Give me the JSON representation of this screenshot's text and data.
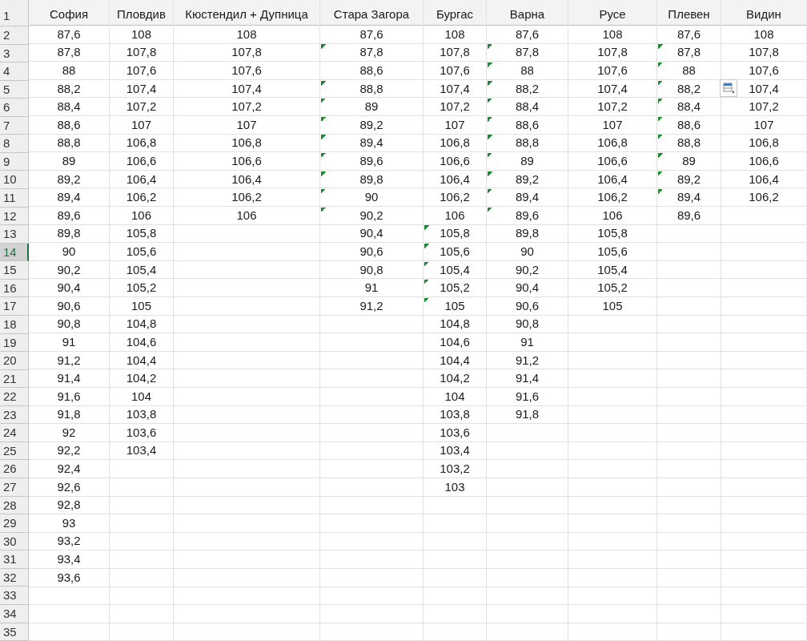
{
  "row_headers": [
    {
      "label": "1",
      "selected": false
    },
    {
      "label": "2",
      "selected": false
    },
    {
      "label": "3",
      "selected": false
    },
    {
      "label": "4",
      "selected": false
    },
    {
      "label": "5",
      "selected": false
    },
    {
      "label": "6",
      "selected": false
    },
    {
      "label": "7",
      "selected": false
    },
    {
      "label": "8",
      "selected": false
    },
    {
      "label": "9",
      "selected": false
    },
    {
      "label": "10",
      "selected": false
    },
    {
      "label": "11",
      "selected": false
    },
    {
      "label": "12",
      "selected": false
    },
    {
      "label": "13",
      "selected": false
    },
    {
      "label": "14",
      "selected": true
    },
    {
      "label": "15",
      "selected": false
    },
    {
      "label": "16",
      "selected": false
    },
    {
      "label": "17",
      "selected": false
    },
    {
      "label": "18",
      "selected": false
    },
    {
      "label": "19",
      "selected": false
    },
    {
      "label": "20",
      "selected": false
    },
    {
      "label": "21",
      "selected": false
    },
    {
      "label": "22",
      "selected": false
    },
    {
      "label": "23",
      "selected": false
    },
    {
      "label": "24",
      "selected": false
    },
    {
      "label": "25",
      "selected": false
    },
    {
      "label": "26",
      "selected": false
    },
    {
      "label": "27",
      "selected": false
    },
    {
      "label": "28",
      "selected": false
    },
    {
      "label": "29",
      "selected": false
    },
    {
      "label": "30",
      "selected": false
    },
    {
      "label": "31",
      "selected": false
    },
    {
      "label": "32",
      "selected": false
    },
    {
      "label": "33",
      "selected": false
    },
    {
      "label": "34",
      "selected": false
    },
    {
      "label": "35",
      "selected": false
    }
  ],
  "columns": [
    {
      "header": "София",
      "cells": [
        {
          "text": "87,6",
          "flagged": false
        },
        {
          "text": "87,8",
          "flagged": false
        },
        {
          "text": "88",
          "flagged": false
        },
        {
          "text": "88,2",
          "flagged": false
        },
        {
          "text": "88,4",
          "flagged": false
        },
        {
          "text": "88,6",
          "flagged": false
        },
        {
          "text": "88,8",
          "flagged": false
        },
        {
          "text": "89",
          "flagged": false
        },
        {
          "text": "89,2",
          "flagged": false
        },
        {
          "text": "89,4",
          "flagged": false
        },
        {
          "text": "89,6",
          "flagged": false
        },
        {
          "text": "89,8",
          "flagged": false
        },
        {
          "text": "90",
          "flagged": false
        },
        {
          "text": "90,2",
          "flagged": false
        },
        {
          "text": "90,4",
          "flagged": false
        },
        {
          "text": "90,6",
          "flagged": false
        },
        {
          "text": "90,8",
          "flagged": false
        },
        {
          "text": "91",
          "flagged": false
        },
        {
          "text": "91,2",
          "flagged": false
        },
        {
          "text": "91,4",
          "flagged": false
        },
        {
          "text": "91,6",
          "flagged": false
        },
        {
          "text": "91,8",
          "flagged": false
        },
        {
          "text": "92",
          "flagged": false
        },
        {
          "text": "92,2",
          "flagged": false
        },
        {
          "text": "92,4",
          "flagged": false
        },
        {
          "text": "92,6",
          "flagged": false
        },
        {
          "text": "92,8",
          "flagged": false
        },
        {
          "text": "93",
          "flagged": false
        },
        {
          "text": "93,2",
          "flagged": false
        },
        {
          "text": "93,4",
          "flagged": false
        },
        {
          "text": "93,6",
          "flagged": false
        }
      ]
    },
    {
      "header": "Пловдив",
      "cells": [
        {
          "text": "108",
          "flagged": false
        },
        {
          "text": "107,8",
          "flagged": false
        },
        {
          "text": "107,6",
          "flagged": false
        },
        {
          "text": "107,4",
          "flagged": false
        },
        {
          "text": "107,2",
          "flagged": false
        },
        {
          "text": "107",
          "flagged": false
        },
        {
          "text": "106,8",
          "flagged": false
        },
        {
          "text": "106,6",
          "flagged": false
        },
        {
          "text": "106,4",
          "flagged": false
        },
        {
          "text": "106,2",
          "flagged": false
        },
        {
          "text": "106",
          "flagged": false
        },
        {
          "text": "105,8",
          "flagged": false
        },
        {
          "text": "105,6",
          "flagged": false
        },
        {
          "text": "105,4",
          "flagged": false
        },
        {
          "text": "105,2",
          "flagged": false
        },
        {
          "text": "105",
          "flagged": false
        },
        {
          "text": "104,8",
          "flagged": false
        },
        {
          "text": "104,6",
          "flagged": false
        },
        {
          "text": "104,4",
          "flagged": false
        },
        {
          "text": "104,2",
          "flagged": false
        },
        {
          "text": "104",
          "flagged": false
        },
        {
          "text": "103,8",
          "flagged": false
        },
        {
          "text": "103,6",
          "flagged": false
        },
        {
          "text": "103,4",
          "flagged": false
        }
      ]
    },
    {
      "header": "Кюстендил + Дупница",
      "cells": [
        {
          "text": "108",
          "flagged": false
        },
        {
          "text": "107,8",
          "flagged": false
        },
        {
          "text": "107,6",
          "flagged": false
        },
        {
          "text": "107,4",
          "flagged": false
        },
        {
          "text": "107,2",
          "flagged": false
        },
        {
          "text": "107",
          "flagged": false
        },
        {
          "text": "106,8",
          "flagged": false
        },
        {
          "text": "106,6",
          "flagged": false
        },
        {
          "text": "106,4",
          "flagged": false
        },
        {
          "text": "106,2",
          "flagged": false
        },
        {
          "text": "106",
          "flagged": false
        }
      ]
    },
    {
      "header": "Стара Загора",
      "cells": [
        {
          "text": "87,6",
          "flagged": false
        },
        {
          "text": "87,8",
          "flagged": true
        },
        {
          "text": "88,6",
          "flagged": false
        },
        {
          "text": "88,8",
          "flagged": true
        },
        {
          "text": "89",
          "flagged": true
        },
        {
          "text": "89,2",
          "flagged": true
        },
        {
          "text": "89,4",
          "flagged": true
        },
        {
          "text": "89,6",
          "flagged": true
        },
        {
          "text": "89,8",
          "flagged": true
        },
        {
          "text": "90",
          "flagged": true
        },
        {
          "text": "90,2",
          "flagged": true
        },
        {
          "text": "90,4",
          "flagged": false
        },
        {
          "text": "90,6",
          "flagged": false
        },
        {
          "text": "90,8",
          "flagged": false
        },
        {
          "text": "91",
          "flagged": false
        },
        {
          "text": "91,2",
          "flagged": false
        }
      ]
    },
    {
      "header": "Бургас",
      "cells": [
        {
          "text": "108",
          "flagged": false
        },
        {
          "text": "107,8",
          "flagged": false
        },
        {
          "text": "107,6",
          "flagged": false
        },
        {
          "text": "107,4",
          "flagged": false
        },
        {
          "text": "107,2",
          "flagged": false
        },
        {
          "text": "107",
          "flagged": false
        },
        {
          "text": "106,8",
          "flagged": false
        },
        {
          "text": "106,6",
          "flagged": false
        },
        {
          "text": "106,4",
          "flagged": false
        },
        {
          "text": "106,2",
          "flagged": false
        },
        {
          "text": "106",
          "flagged": false
        },
        {
          "text": "105,8",
          "flagged": true
        },
        {
          "text": "105,6",
          "flagged": true
        },
        {
          "text": "105,4",
          "flagged": true
        },
        {
          "text": "105,2",
          "flagged": true
        },
        {
          "text": "105",
          "flagged": true
        },
        {
          "text": "104,8",
          "flagged": false
        },
        {
          "text": "104,6",
          "flagged": false
        },
        {
          "text": "104,4",
          "flagged": false
        },
        {
          "text": "104,2",
          "flagged": false
        },
        {
          "text": "104",
          "flagged": false
        },
        {
          "text": "103,8",
          "flagged": false
        },
        {
          "text": "103,6",
          "flagged": false
        },
        {
          "text": "103,4",
          "flagged": false
        },
        {
          "text": "103,2",
          "flagged": false
        },
        {
          "text": "103",
          "flagged": false
        }
      ]
    },
    {
      "header": "Варна",
      "cells": [
        {
          "text": "87,6",
          "flagged": false
        },
        {
          "text": "87,8",
          "flagged": true
        },
        {
          "text": "88",
          "flagged": true
        },
        {
          "text": "88,2",
          "flagged": true
        },
        {
          "text": "88,4",
          "flagged": true
        },
        {
          "text": "88,6",
          "flagged": true
        },
        {
          "text": "88,8",
          "flagged": true
        },
        {
          "text": "89",
          "flagged": true
        },
        {
          "text": "89,2",
          "flagged": true
        },
        {
          "text": "89,4",
          "flagged": true
        },
        {
          "text": "89,6",
          "flagged": true
        },
        {
          "text": "89,8",
          "flagged": false
        },
        {
          "text": "90",
          "flagged": false
        },
        {
          "text": "90,2",
          "flagged": false
        },
        {
          "text": "90,4",
          "flagged": false
        },
        {
          "text": "90,6",
          "flagged": false
        },
        {
          "text": "90,8",
          "flagged": false
        },
        {
          "text": "91",
          "flagged": false
        },
        {
          "text": "91,2",
          "flagged": false
        },
        {
          "text": "91,4",
          "flagged": false
        },
        {
          "text": "91,6",
          "flagged": false
        },
        {
          "text": "91,8",
          "flagged": false
        }
      ]
    },
    {
      "header": "Русе",
      "cells": [
        {
          "text": "108",
          "flagged": false
        },
        {
          "text": "107,8",
          "flagged": false
        },
        {
          "text": "107,6",
          "flagged": false
        },
        {
          "text": "107,4",
          "flagged": false
        },
        {
          "text": "107,2",
          "flagged": false
        },
        {
          "text": "107",
          "flagged": false
        },
        {
          "text": "106,8",
          "flagged": false
        },
        {
          "text": "106,6",
          "flagged": false
        },
        {
          "text": "106,4",
          "flagged": false
        },
        {
          "text": "106,2",
          "flagged": false
        },
        {
          "text": "106",
          "flagged": false
        },
        {
          "text": "105,8",
          "flagged": false
        },
        {
          "text": "105,6",
          "flagged": false
        },
        {
          "text": "105,4",
          "flagged": false
        },
        {
          "text": "105,2",
          "flagged": false
        },
        {
          "text": "105",
          "flagged": false
        }
      ]
    },
    {
      "header": "Плевен",
      "cells": [
        {
          "text": "87,6",
          "flagged": false
        },
        {
          "text": "87,8",
          "flagged": true
        },
        {
          "text": "88",
          "flagged": true
        },
        {
          "text": "88,2",
          "flagged": true
        },
        {
          "text": "88,4",
          "flagged": true
        },
        {
          "text": "88,6",
          "flagged": true
        },
        {
          "text": "88,8",
          "flagged": true
        },
        {
          "text": "89",
          "flagged": true
        },
        {
          "text": "89,2",
          "flagged": true
        },
        {
          "text": "89,4",
          "flagged": true
        },
        {
          "text": "89,6",
          "flagged": false
        }
      ]
    },
    {
      "header": "Видин",
      "cells": [
        {
          "text": "108",
          "flagged": false
        },
        {
          "text": "107,8",
          "flagged": false
        },
        {
          "text": "107,6",
          "flagged": false
        },
        {
          "text": "107,4",
          "flagged": false
        },
        {
          "text": "107,2",
          "flagged": false
        },
        {
          "text": "107",
          "flagged": false
        },
        {
          "text": "106,8",
          "flagged": false
        },
        {
          "text": "106,6",
          "flagged": false
        },
        {
          "text": "106,4",
          "flagged": false
        },
        {
          "text": "106,2",
          "flagged": false
        }
      ]
    }
  ]
}
